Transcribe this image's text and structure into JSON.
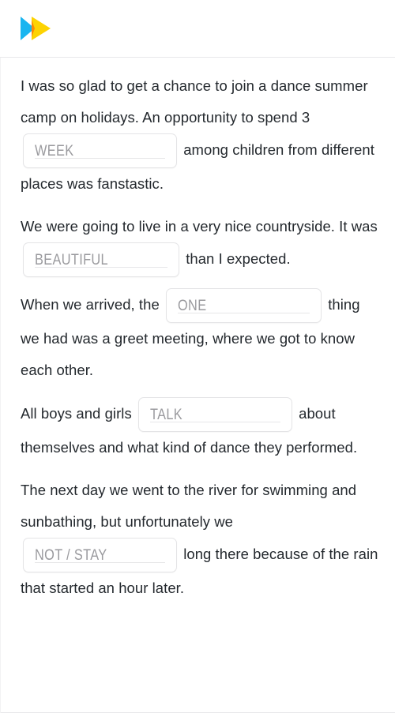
{
  "header": {
    "logo_name": "double-play-arrow-logo",
    "logo_colors": {
      "left_arrow": "#19b5f0",
      "right_arrow": "#fdd302",
      "overlap": "#f98a06"
    }
  },
  "exercise": {
    "paragraphs": [
      {
        "id": "p1",
        "before": "I was so glad to get a chance to join a dance summer camp on holidays. An opportunity to spend 3 ",
        "gap": {
          "placeholder": "WEEK",
          "value": ""
        },
        "after": " among children from different places was fanstastic."
      },
      {
        "id": "p2",
        "before": "We were going to live in a very nice countryside. It was ",
        "gap": {
          "placeholder": "BEAUTIFUL",
          "value": ""
        },
        "after": " than I expected."
      },
      {
        "id": "p3",
        "before": "When we arrived, the ",
        "gap": {
          "placeholder": "ONE",
          "value": ""
        },
        "after": " thing we had was a greet meeting, where we got to know each other."
      },
      {
        "id": "p4",
        "before": "All boys and girls ",
        "gap": {
          "placeholder": "TALK",
          "value": ""
        },
        "after": " about themselves and what kind of dance they performed."
      },
      {
        "id": "p5",
        "before": "The next day we went to the river for swimming and sunbathing, but unfortunately we ",
        "gap": {
          "placeholder": "NOT / STAY",
          "value": ""
        },
        "after": " long there because of the rain that started an hour later."
      }
    ]
  },
  "colors": {
    "text": "#24292e",
    "placeholder": "#9a9a9e",
    "field_border": "#e4e4e6",
    "divider": "#e8e8ea",
    "background": "#ffffff"
  }
}
